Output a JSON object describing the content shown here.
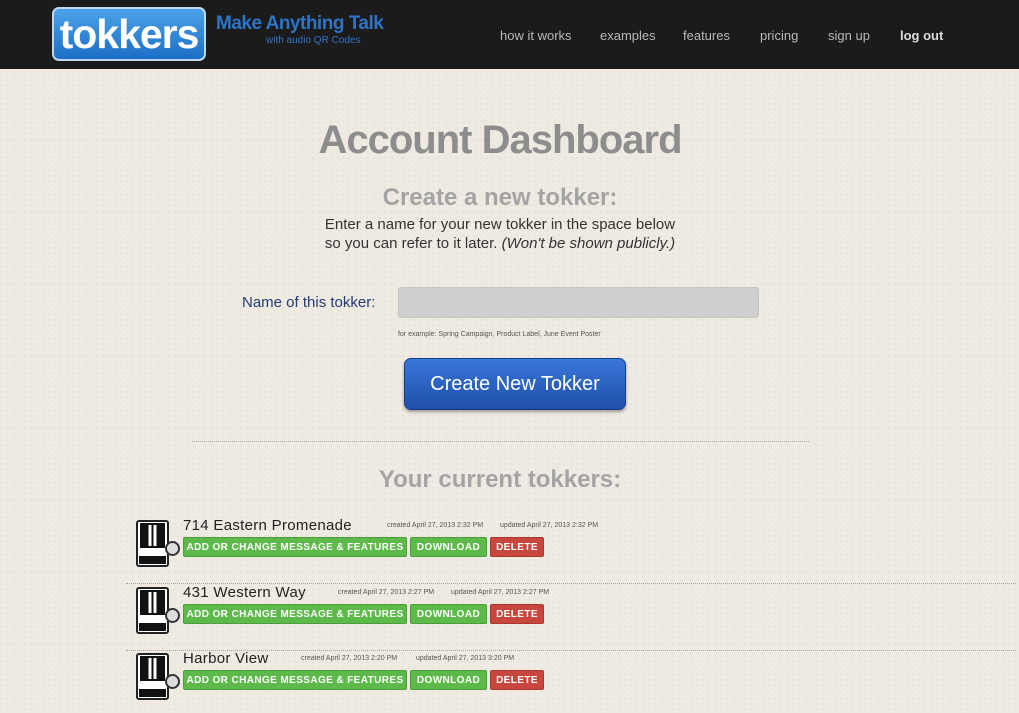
{
  "header": {
    "logo_text": "tokkers",
    "tagline": "Make Anything Talk",
    "tagline_sub": "with audio QR Codes",
    "nav": [
      "how it works",
      "examples",
      "features",
      "pricing",
      "sign up",
      "log out"
    ]
  },
  "main": {
    "title": "Account Dashboard",
    "create_heading": "Create a new tokker:",
    "create_desc_line1": "Enter a name for your new tokker in the space below",
    "create_desc_line2": "so you can refer to it later.",
    "create_desc_note": "(Won't be shown publicly.)",
    "name_label": "Name of this tokker:",
    "name_value": "",
    "example_hint": "for example: Spring Campaign, Product Label, June Event Poster",
    "create_button": "Create New Tokker",
    "current_heading": "Your current tokkers:"
  },
  "tokkers": [
    {
      "name": "714 Eastern Promenade",
      "created": "created April 27, 2013 2:32 PM",
      "updated": "updated April 27, 2013 2:32 PM",
      "actions": [
        "ADD OR CHANGE MESSAGE & FEATURES",
        "DOWNLOAD",
        "DELETE"
      ]
    },
    {
      "name": "431 Western Way",
      "created": "created April 27, 2013 2:27 PM",
      "updated": "updated April 27, 2013 2:27 PM",
      "actions": [
        "ADD OR CHANGE MESSAGE & FEATURES",
        "DOWNLOAD",
        "DELETE"
      ]
    },
    {
      "name": "Harbor View",
      "created": "created April 27, 2013 2:20 PM",
      "updated": "updated April 27, 2013 3:20 PM",
      "actions": [
        "ADD OR CHANGE MESSAGE & FEATURES",
        "DOWNLOAD",
        "DELETE"
      ]
    }
  ],
  "colors": {
    "header_bg": "#1b1b1b",
    "brand_blue": "#2d74c8",
    "primary_button": "#2a5fc0",
    "green_action": "#5db94a",
    "red_action": "#c9463e"
  }
}
